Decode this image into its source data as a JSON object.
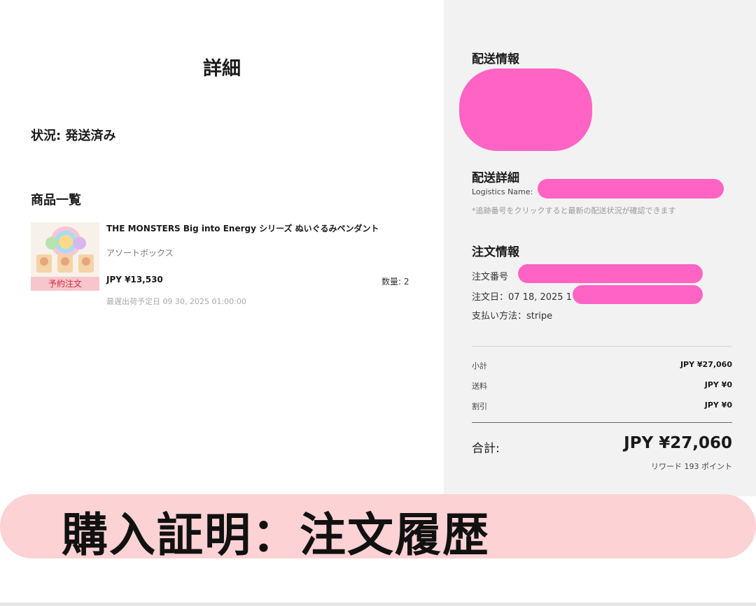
{
  "detail": {
    "title": "詳細",
    "status": "状況: 発送済み",
    "products_heading": "商品一覧",
    "product": {
      "name": "THE MONSTERS Big into Energy シリーズ ぬいぐるみペンダント",
      "variant": "アソートボックス",
      "price": "JPY ¥13,530",
      "quantity": "数量: 2",
      "ship_date": "最遅出荷予定日 09 30, 2025 01:00:00",
      "badge": "予約注文"
    }
  },
  "shipping": {
    "info_heading": "配送情報",
    "detail_heading": "配送詳細",
    "logistics_label": "Logistics Name:",
    "note": "*追跡番号をクリックすると最新の配送状況が確認できます"
  },
  "order": {
    "heading": "注文情報",
    "number_label": "注文番号",
    "date_label": "注文日：07 18, 2025 1",
    "payment": "支払い方法：stripe"
  },
  "summary": {
    "subtotal_label": "小計",
    "subtotal_value": "JPY ¥27,060",
    "shipping_label": "送料",
    "shipping_value": "JPY ¥0",
    "discount_label": "割引",
    "discount_value": "JPY ¥0",
    "total_label": "合計:",
    "total_value": "JPY ¥27,060",
    "reward": "リワード 193 ポイント"
  },
  "banner": {
    "text": "購入証明：注文履歴"
  },
  "colors": {
    "redaction": "#ff63c4",
    "banner": "#fcd2d4",
    "badge_bg": "#f6c6cc",
    "badge_text": "#d22a3a"
  }
}
